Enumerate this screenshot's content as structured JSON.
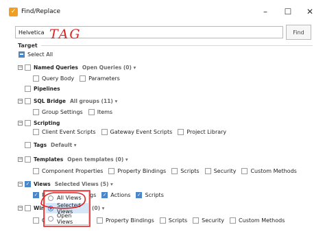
{
  "window": {
    "title": "Find/Replace",
    "app_icon": "ignition-check-icon",
    "controls": [
      "minimize",
      "maximize",
      "close"
    ]
  },
  "search": {
    "value": "Helvetica",
    "find_label": "Find"
  },
  "annotation": {
    "text": "TAG",
    "color": "#e02020"
  },
  "target": {
    "label": "Target",
    "select_all": "Select All",
    "named_queries": {
      "label": "Named Queries",
      "dropdown": "Open Queries (0) ▾",
      "children": [
        "Query Body",
        "Parameters"
      ]
    },
    "pipelines": {
      "label": "Pipelines"
    },
    "sql_bridge": {
      "label": "SQL Bridge",
      "dropdown": "All groups (11) ▾",
      "children": [
        "Group Settings",
        "Items"
      ]
    },
    "scripting": {
      "label": "Scripting",
      "children": [
        "Client Event Scripts",
        "Gateway Event Scripts",
        "Project Library"
      ]
    },
    "tags": {
      "label": "Tags",
      "dropdown": "Default ▾"
    },
    "templates": {
      "label": "Templates",
      "dropdown": "Open templates (0) ▾",
      "children": [
        "Component Properties",
        "Property Bindings",
        "Scripts",
        "Security",
        "Custom Methods"
      ]
    },
    "views": {
      "label": "Views",
      "dropdown": "Selected Views (5) ▾",
      "children_visible": [
        "P",
        "gs",
        "Actions",
        "Scripts"
      ]
    },
    "windows": {
      "label": "Windo",
      "dropdown": "(0) ▾",
      "children_visible": [
        "C",
        "Property Bindings",
        "Scripts",
        "Security",
        "Custom Methods"
      ]
    }
  },
  "popup": {
    "options": [
      "All Views",
      "Selected Views",
      "Open Views"
    ],
    "selected": "Selected Views"
  }
}
